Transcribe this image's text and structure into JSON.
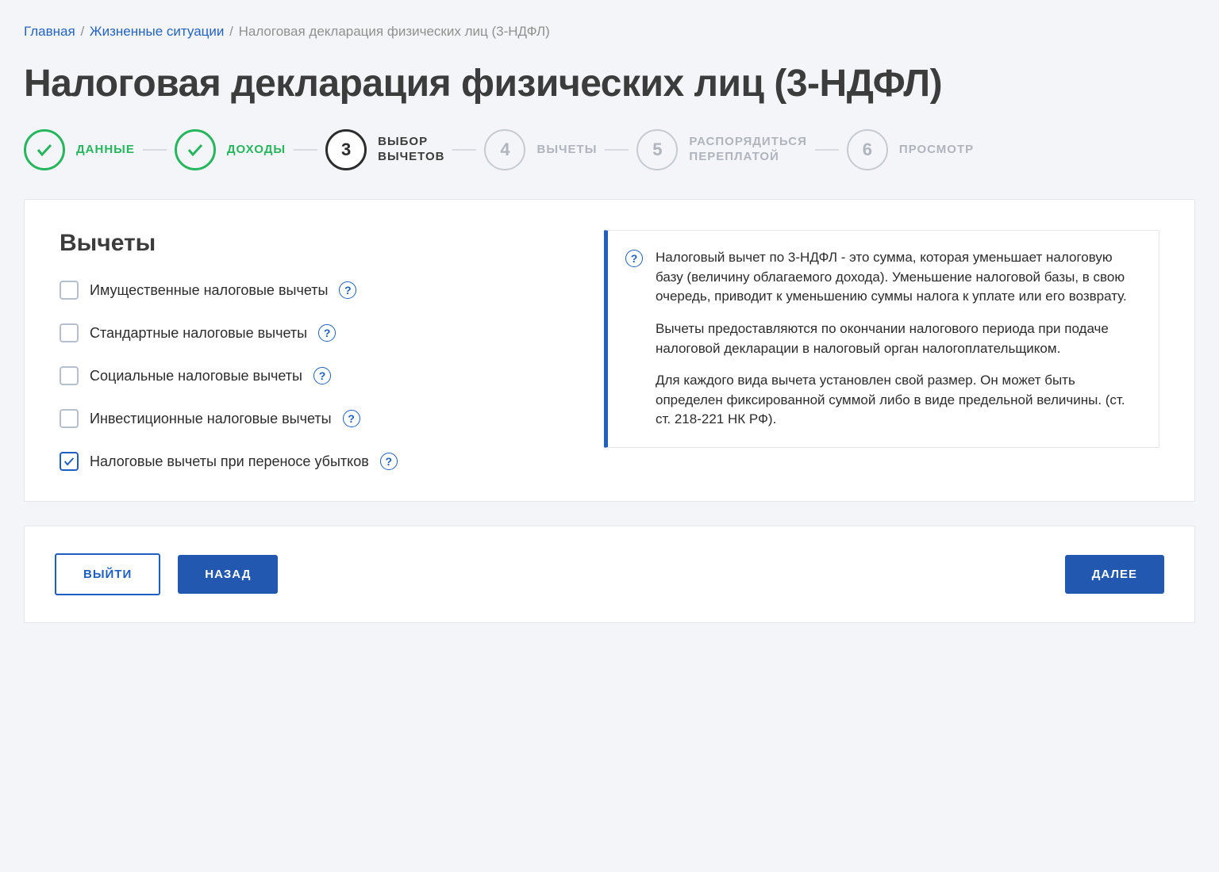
{
  "breadcrumb": {
    "home": "Главная",
    "situations": "Жизненные ситуации",
    "current": "Налоговая декларация физических лиц (3-НДФЛ)"
  },
  "page_title": "Налоговая декларация физических лиц (3-НДФЛ)",
  "steps": [
    {
      "num": "1",
      "label": "ДАННЫЕ",
      "status": "done"
    },
    {
      "num": "2",
      "label": "ДОХОДЫ",
      "status": "done"
    },
    {
      "num": "3",
      "label": "ВЫБОР\nВЫЧЕТОВ",
      "status": "active"
    },
    {
      "num": "4",
      "label": "ВЫЧЕТЫ",
      "status": "upcoming"
    },
    {
      "num": "5",
      "label": "РАСПОРЯДИТЬСЯ\nПЕРЕПЛАТОЙ",
      "status": "upcoming"
    },
    {
      "num": "6",
      "label": "ПРОСМОТР",
      "status": "upcoming"
    }
  ],
  "section_title": "Вычеты",
  "deductions": [
    {
      "label": "Имущественные налоговые вычеты",
      "checked": false
    },
    {
      "label": "Стандартные налоговые вычеты",
      "checked": false
    },
    {
      "label": "Социальные налоговые вычеты",
      "checked": false
    },
    {
      "label": "Инвестиционные налоговые вычеты",
      "checked": false
    },
    {
      "label": "Налоговые вычеты при переносе убытков",
      "checked": true
    }
  ],
  "info": {
    "p1": "Налоговый вычет по 3-НДФЛ - это сумма, которая уменьшает налоговую базу (величину облагаемого дохода). Уменьшение налоговой базы, в свою очередь, приводит к уменьшению суммы налога к уплате или его возврату.",
    "p2": "Вычеты предоставляются по окончании налогового периода при подаче налоговой декларации в налоговый орган налогоплательщиком.",
    "p3": "Для каждого вида вычета установлен свой размер. Он может быть определен фиксированной суммой либо в виде предельной величины. (ст. ст. 218-221 НК РФ)."
  },
  "buttons": {
    "exit": "ВЫЙТИ",
    "back": "НАЗАД",
    "next": "ДАЛЕЕ"
  }
}
